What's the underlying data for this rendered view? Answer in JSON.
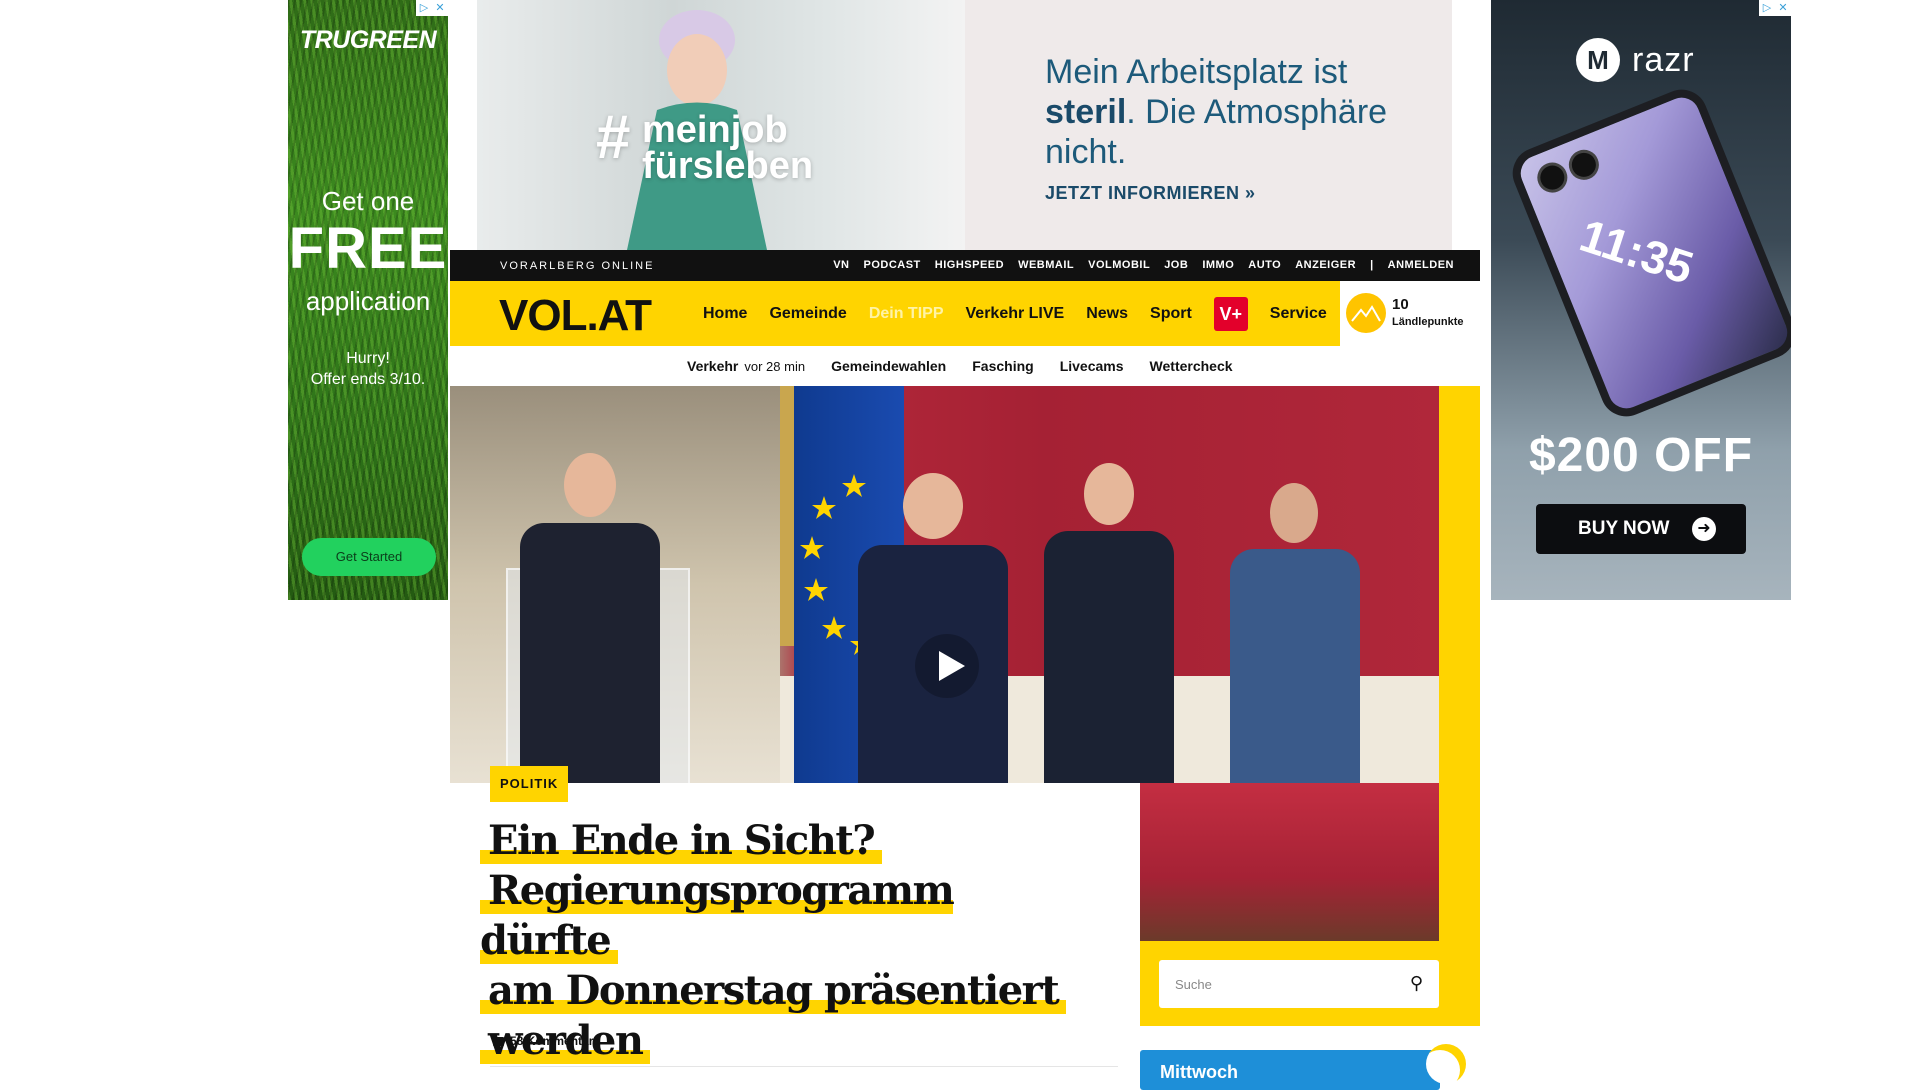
{
  "ads": {
    "left": {
      "brand": "TRUGREEN",
      "line1": "Get one",
      "line2": "FREE",
      "line3": "application",
      "line4": "Hurry!",
      "line5": "Offer ends 3/10.",
      "cta": "Get Started"
    },
    "top": {
      "hashtag_line1": "meinjob",
      "hashtag_line2": "fürsleben",
      "headline_pre": "Mein Arbeitsplatz ist",
      "headline_bold": "steril",
      "headline_post": ". Die Atmosphäre nicht.",
      "link": "JETZT INFORMIEREN »"
    },
    "right": {
      "brand": "razr",
      "phone_time": "11:35",
      "offer": "$200 OFF",
      "cta": "BUY NOW"
    }
  },
  "site": {
    "tagline": "VORARLBERG ONLINE",
    "top_links": [
      "VN",
      "PODCAST",
      "HIGHSPEED",
      "WEBMAIL",
      "VOLMOBIL",
      "JOB",
      "IMMO",
      "AUTO",
      "ANZEIGER",
      "|",
      "ANMELDEN"
    ],
    "logo": "VOL.AT",
    "menu": [
      "Home",
      "Gemeinde",
      "Dein TIPP",
      "Verkehr LIVE",
      "News",
      "Sport",
      "V+",
      "Service"
    ],
    "points": {
      "value": "10",
      "label": "Ländlepunkte"
    },
    "subnav": {
      "verkehr": "Verkehr",
      "verkehr_time": "vor 28 min",
      "items": [
        "Gemeindewahlen",
        "Fasching",
        "Livecams",
        "Wettercheck"
      ]
    },
    "search_placeholder": "Suche",
    "weather_day": "Mittwoch"
  },
  "article": {
    "category": "POLITIK",
    "title_lines": [
      "Ein Ende in Sicht?",
      "Regierungsprogramm dürfte",
      "am Donnerstag präsentiert",
      "werden"
    ],
    "comments": "58 Kommentare"
  },
  "colors": {
    "brand_yellow": "#ffd400",
    "vplus_red": "#e3002b",
    "ad_green_cta": "#22d15e",
    "ad_blue_text": "#1a4a69"
  }
}
